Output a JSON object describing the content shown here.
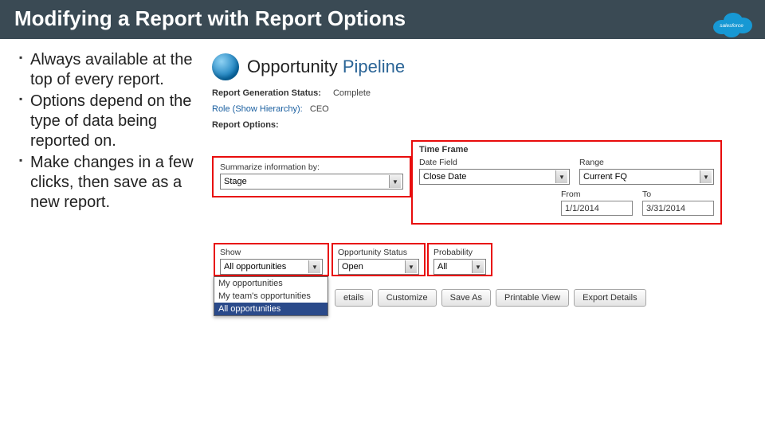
{
  "slide": {
    "title": "Modifying a Report with Report Options",
    "bullets": [
      "Always available at the top of every report.",
      "Options depend on the type of data being reported on.",
      "Make changes in a few clicks, then save as a new report."
    ]
  },
  "report": {
    "title_a": "Opportunity",
    "title_b": "Pipeline",
    "status_label": "Report Generation Status:",
    "status_value": "Complete",
    "role_label": "Role (Show Hierarchy):",
    "role_value": "CEO",
    "options_label": "Report Options:",
    "summarize": {
      "label": "Summarize information by:",
      "value": "Stage"
    },
    "timeframe": {
      "header": "Time Frame",
      "date_field_label": "Date Field",
      "date_field_value": "Close Date",
      "range_label": "Range",
      "range_value": "Current FQ",
      "from_label": "From",
      "from_value": "1/1/2014",
      "to_label": "To",
      "to_value": "3/31/2014"
    },
    "show": {
      "label": "Show",
      "value": "All opportunities",
      "options": [
        "My opportunities",
        "My team's opportunities",
        "All opportunities"
      ]
    },
    "opp_status": {
      "label": "Opportunity Status",
      "value": "Open"
    },
    "probability": {
      "label": "Probability",
      "value": "All"
    },
    "buttons": [
      "etails",
      "Customize",
      "Save As",
      "Printable View",
      "Export Details"
    ]
  }
}
